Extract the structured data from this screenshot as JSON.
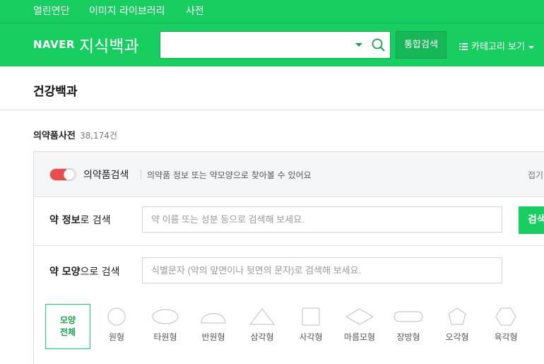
{
  "topbar": {
    "items": [
      "열린연단",
      "이미지 라이브러리",
      "사전"
    ]
  },
  "header": {
    "logo_naver": "NAVER",
    "logo_title": "지식백과",
    "search_value": "",
    "total_search_label": "통합검색",
    "category_label": "카테고리 보기"
  },
  "page": {
    "title": "건강백과"
  },
  "dictionary": {
    "name": "의약품사전",
    "count": "38,174건"
  },
  "panel": {
    "toggle_label": "의약품검색",
    "description": "의약품 정보 또는 약모양으로 찾아볼 수 있어요",
    "fold_label": "접기",
    "info_search": {
      "label_bold": "약 정보",
      "label_rest": "로 검색",
      "placeholder": "약 이름 또는 성분 등으로 검색해 보세요.",
      "button": "검색"
    },
    "shape_search": {
      "label_bold": "약 모양",
      "label_rest": "으로 검색",
      "placeholder": "식별문자 (약의 앞면이나 뒷면의 문자)로 검색해 보세요."
    },
    "shape_all": {
      "line1": "모양",
      "line2": "전체"
    },
    "shapes": [
      "원형",
      "타원형",
      "반원형",
      "삼각형",
      "사각형",
      "마름모형",
      "장방형",
      "오각형",
      "육각형"
    ]
  },
  "colors": {
    "brand_green": "#19ce60",
    "toggle_red": "#ea4d4d"
  }
}
